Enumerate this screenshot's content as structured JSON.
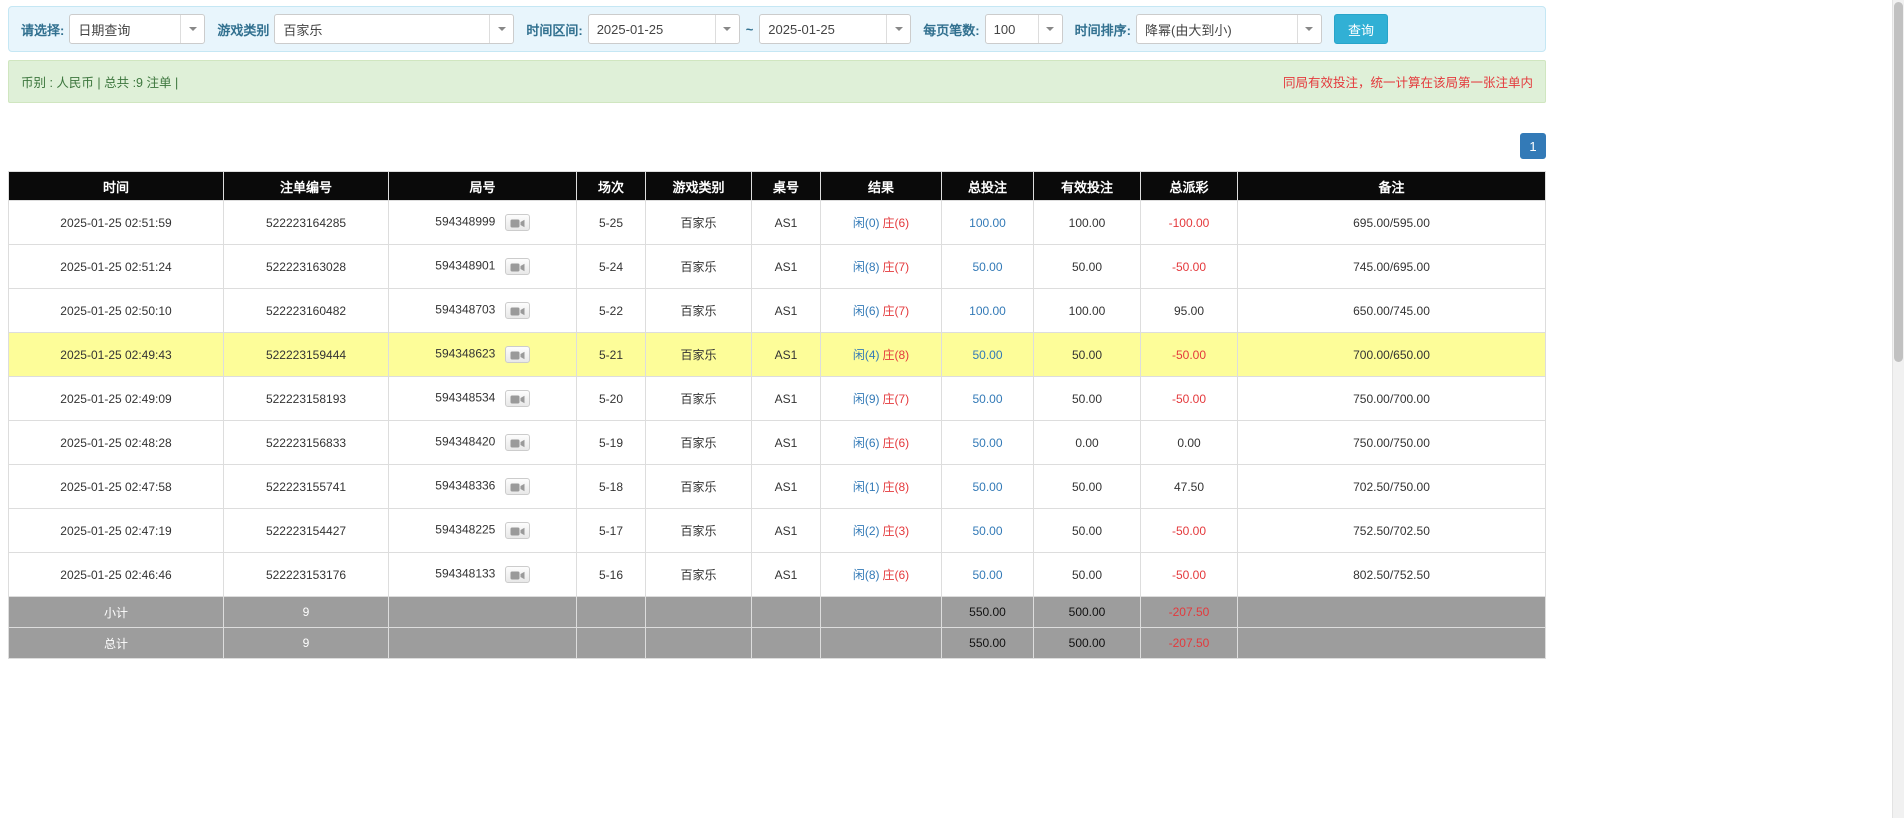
{
  "filters": {
    "select_label": "请选择:",
    "query_type": "日期查询",
    "game_label": "游戏类别",
    "game_type": "百家乐",
    "range_label": "时间区间:",
    "date_from": "2025-01-25",
    "date_separator": "~",
    "date_to": "2025-01-25",
    "page_size_label": "每页笔数:",
    "page_size": "100",
    "sort_label": "时间排序:",
    "sort_order": "降幂(由大到小)",
    "search_button": "查询"
  },
  "summary": {
    "left": "币别 : 人民币 | 总共 :9 注单 |",
    "notice": "同局有效投注，统一计算在该局第一张注单内"
  },
  "pagination": {
    "current": "1"
  },
  "icons": {
    "combo_caret": "chevron-down-icon",
    "round_action": "replay-video-icon"
  },
  "table": {
    "headers": [
      "时间",
      "注单编号",
      "局号",
      "场次",
      "游戏类别",
      "桌号",
      "结果",
      "总投注",
      "有效投注",
      "总派彩",
      "备注"
    ],
    "rows": [
      {
        "time": "2025-01-25 02:51:59",
        "bet_id": "522223164285",
        "round_id": "594348999",
        "session": "5-25",
        "game": "百家乐",
        "table_no": "AS1",
        "player": "闲(0)",
        "banker": "庄(6)",
        "total_bet": "100.00",
        "valid_bet": "100.00",
        "payout": "-100.00",
        "note": "695.00/595.00",
        "highlight": false
      },
      {
        "time": "2025-01-25 02:51:24",
        "bet_id": "522223163028",
        "round_id": "594348901",
        "session": "5-24",
        "game": "百家乐",
        "table_no": "AS1",
        "player": "闲(8)",
        "banker": "庄(7)",
        "total_bet": "50.00",
        "valid_bet": "50.00",
        "payout": "-50.00",
        "note": "745.00/695.00",
        "highlight": false
      },
      {
        "time": "2025-01-25 02:50:10",
        "bet_id": "522223160482",
        "round_id": "594348703",
        "session": "5-22",
        "game": "百家乐",
        "table_no": "AS1",
        "player": "闲(6)",
        "banker": "庄(7)",
        "total_bet": "100.00",
        "valid_bet": "100.00",
        "payout": "95.00",
        "note": "650.00/745.00",
        "highlight": false
      },
      {
        "time": "2025-01-25 02:49:43",
        "bet_id": "522223159444",
        "round_id": "594348623",
        "session": "5-21",
        "game": "百家乐",
        "table_no": "AS1",
        "player": "闲(4)",
        "banker": "庄(8)",
        "total_bet": "50.00",
        "valid_bet": "50.00",
        "payout": "-50.00",
        "note": "700.00/650.00",
        "highlight": true
      },
      {
        "time": "2025-01-25 02:49:09",
        "bet_id": "522223158193",
        "round_id": "594348534",
        "session": "5-20",
        "game": "百家乐",
        "table_no": "AS1",
        "player": "闲(9)",
        "banker": "庄(7)",
        "total_bet": "50.00",
        "valid_bet": "50.00",
        "payout": "-50.00",
        "note": "750.00/700.00",
        "highlight": false
      },
      {
        "time": "2025-01-25 02:48:28",
        "bet_id": "522223156833",
        "round_id": "594348420",
        "session": "5-19",
        "game": "百家乐",
        "table_no": "AS1",
        "player": "闲(6)",
        "banker": "庄(6)",
        "total_bet": "50.00",
        "valid_bet": "0.00",
        "payout": "0.00",
        "note": "750.00/750.00",
        "highlight": false
      },
      {
        "time": "2025-01-25 02:47:58",
        "bet_id": "522223155741",
        "round_id": "594348336",
        "session": "5-18",
        "game": "百家乐",
        "table_no": "AS1",
        "player": "闲(1)",
        "banker": "庄(8)",
        "total_bet": "50.00",
        "valid_bet": "50.00",
        "payout": "47.50",
        "note": "702.50/750.00",
        "highlight": false
      },
      {
        "time": "2025-01-25 02:47:19",
        "bet_id": "522223154427",
        "round_id": "594348225",
        "session": "5-17",
        "game": "百家乐",
        "table_no": "AS1",
        "player": "闲(2)",
        "banker": "庄(3)",
        "total_bet": "50.00",
        "valid_bet": "50.00",
        "payout": "-50.00",
        "note": "752.50/702.50",
        "highlight": false
      },
      {
        "time": "2025-01-25 02:46:46",
        "bet_id": "522223153176",
        "round_id": "594348133",
        "session": "5-16",
        "game": "百家乐",
        "table_no": "AS1",
        "player": "闲(8)",
        "banker": "庄(6)",
        "total_bet": "50.00",
        "valid_bet": "50.00",
        "payout": "-50.00",
        "note": "802.50/752.50",
        "highlight": false
      }
    ],
    "footer": [
      {
        "label": "小计",
        "count": "9",
        "total_bet": "550.00",
        "valid_bet": "500.00",
        "payout": "-207.50"
      },
      {
        "label": "总计",
        "count": "9",
        "total_bet": "550.00",
        "valid_bet": "500.00",
        "payout": "-207.50"
      }
    ]
  },
  "colors": {
    "accent_blue": "#337ab7",
    "negative_red": "#e4393c",
    "search_button": "#31b0d5",
    "highlight_row": "#fdfd99",
    "header_bg": "#0a0a0a",
    "footer_bg": "#9d9d9d",
    "filter_bar_bg": "#e8f5fc",
    "summary_bar_bg": "#dff0d8"
  }
}
